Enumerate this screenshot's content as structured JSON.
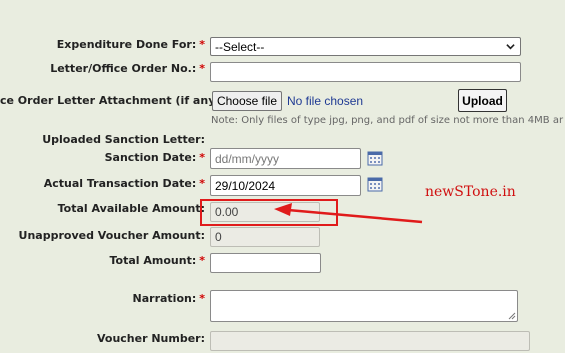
{
  "form": {
    "expenditure": {
      "label": "Expenditure Done For:",
      "selected": "--Select--"
    },
    "letter_no": {
      "label": "Letter/Office Order No.:",
      "value": ""
    },
    "attachment": {
      "label": "ce Order Letter Attachment (if any):",
      "choose_label": "Choose file",
      "file_status": "No file chosen",
      "upload_label": "Upload",
      "note": "Note: Only files of type jpg, png, and pdf of size not more than 4MB ar"
    },
    "uploaded_letter": {
      "label": "Uploaded Sanction Letter:"
    },
    "sanction_date": {
      "label": "Sanction Date:",
      "placeholder": "dd/mm/yyyy"
    },
    "transaction_date": {
      "label": "Actual Transaction Date:",
      "value": "29/10/2024"
    },
    "total_available": {
      "label": "Total Available Amount:",
      "value": "0.00"
    },
    "unapproved": {
      "label": "Unapproved Voucher Amount:",
      "value": "0"
    },
    "total_amount": {
      "label": "Total Amount:",
      "value": ""
    },
    "narration": {
      "label": "Narration:",
      "value": ""
    },
    "voucher_number": {
      "label": "Voucher Number:",
      "value": ""
    }
  },
  "required_marker": "*",
  "watermark": "newSTone.in",
  "colors": {
    "background": "#e9ede0",
    "required": "#d00000",
    "annotation": "#e01b1b",
    "link_text": "#1f3a93"
  },
  "icons": [
    "calendar-icon",
    "chevron-down-icon",
    "resize-grip-icon",
    "arrow-annotation"
  ]
}
